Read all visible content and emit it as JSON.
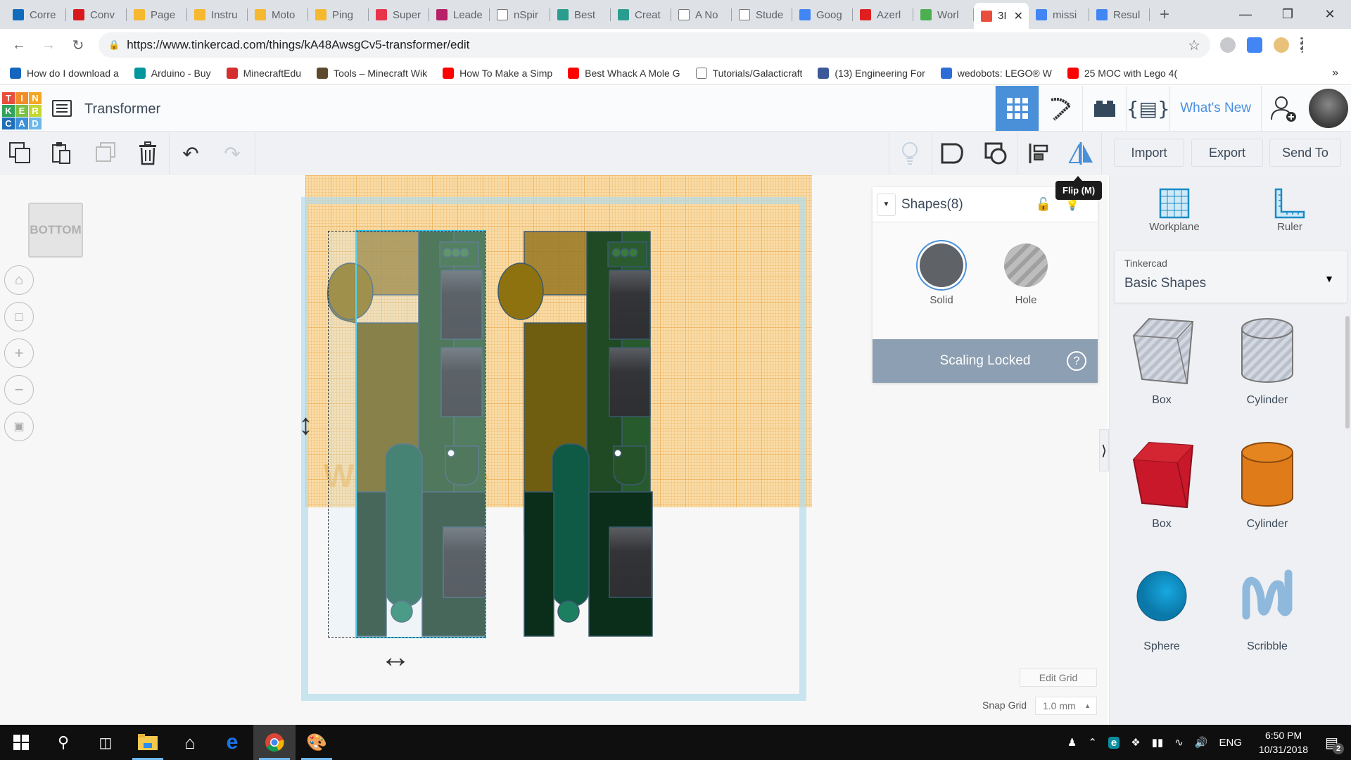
{
  "browser": {
    "tabs": [
      {
        "label": "Corre",
        "icon": "outlook-icon",
        "color": "#0f6cbd"
      },
      {
        "label": "Conv",
        "icon": "m-icon",
        "color": "#d7191c"
      },
      {
        "label": "Page",
        "icon": "instructables-icon",
        "color": "#f5b82e"
      },
      {
        "label": "Instru",
        "icon": "instructables-icon",
        "color": "#f5b82e"
      },
      {
        "label": "Moto",
        "icon": "instructables-icon",
        "color": "#f5b82e"
      },
      {
        "label": "Ping",
        "icon": "instructables-icon",
        "color": "#f5b82e"
      },
      {
        "label": "Super",
        "icon": "bulb-icon",
        "color": "#e8334a"
      },
      {
        "label": "Leade",
        "icon": "edx-icon",
        "color": "#b62168"
      },
      {
        "label": "nSpir",
        "icon": "doc-icon",
        "color": "#ffffff"
      },
      {
        "label": "Best",
        "icon": "tree-icon",
        "color": "#2a9d8f"
      },
      {
        "label": "Creat",
        "icon": "tree-icon",
        "color": "#2a9d8f"
      },
      {
        "label": "A No",
        "icon": "doc-icon",
        "color": "#ffffff"
      },
      {
        "label": "Stude",
        "icon": "doc-icon",
        "color": "#ffffff"
      },
      {
        "label": "Goog",
        "icon": "translate-icon",
        "color": "#4285f4"
      },
      {
        "label": "Azerl",
        "icon": "u-icon",
        "color": "#e02020"
      },
      {
        "label": "Worl",
        "icon": "wes-icon",
        "color": "#4caf50"
      },
      {
        "label": "3I",
        "icon": "tinkercad-icon",
        "color": "#e94e3c",
        "active": true
      },
      {
        "label": "missi",
        "icon": "google-icon",
        "color": "#4285f4"
      },
      {
        "label": "Resul",
        "icon": "google-icon",
        "color": "#4285f4"
      }
    ],
    "new_tab": "+",
    "url": "https://www.tinkercad.com/things/kA48AwsgCv5-transformer/edit",
    "bookmarks": [
      {
        "label": "How do I download a",
        "color": "#1565c0"
      },
      {
        "label": "Arduino - Buy",
        "color": "#00979c"
      },
      {
        "label": "MinecraftEdu",
        "color": "#d32f2f"
      },
      {
        "label": "Tools – Minecraft Wik",
        "color": "#5d4a2c"
      },
      {
        "label": "How To Make a Simp",
        "color": "#ff0000"
      },
      {
        "label": "Best Whack A Mole G",
        "color": "#ff0000"
      },
      {
        "label": "Tutorials/Galacticraft",
        "color": "#ffffff"
      },
      {
        "label": "(13) Engineering For",
        "color": "#3b5998"
      },
      {
        "label": "wedobots: LEGO® W",
        "color": "#2d6ed6"
      },
      {
        "label": "25 MOC with Lego 4(",
        "color": "#ff0000"
      }
    ],
    "bookmarks_more": "»"
  },
  "app": {
    "logo_letters": [
      "T",
      "I",
      "N",
      "K",
      "E",
      "R",
      "C",
      "A",
      "D"
    ],
    "logo_colors": [
      "#e84d3d",
      "#f28c28",
      "#f5a623",
      "#2ea35a",
      "#7cc142",
      "#c4d630",
      "#1e6fb8",
      "#3c8fd8",
      "#6db8e8"
    ],
    "project_title": "Transformer",
    "whats_new": "What's New",
    "accent": "#4a90d9"
  },
  "toolbar": {
    "import": "Import",
    "export": "Export",
    "send_to": "Send To",
    "tooltip": "Flip (M)"
  },
  "viewport": {
    "viewcube": "BOTTOM",
    "workplane_label": "Workplane"
  },
  "inspector": {
    "title": "Shapes(8)",
    "solid": "Solid",
    "hole": "Hole",
    "scaling": "Scaling Locked",
    "help": "?"
  },
  "grid": {
    "edit_grid": "Edit Grid",
    "snap_label": "Snap Grid",
    "snap_value": "1.0 mm"
  },
  "library": {
    "tools": [
      {
        "label": "Workplane"
      },
      {
        "label": "Ruler"
      }
    ],
    "source": "Tinkercad",
    "category": "Basic Shapes",
    "shapes": [
      {
        "label": "Box",
        "kind": "hole-box"
      },
      {
        "label": "Cylinder",
        "kind": "hole-cylinder"
      },
      {
        "label": "Box",
        "kind": "box",
        "color": "#c8182a"
      },
      {
        "label": "Cylinder",
        "kind": "cylinder",
        "color": "#e07b1a"
      },
      {
        "label": "Sphere",
        "kind": "sphere",
        "color": "#0f8fc8"
      },
      {
        "label": "Scribble",
        "kind": "scribble",
        "color": "#8fb9dc"
      }
    ]
  },
  "taskbar": {
    "time": "6:50 PM",
    "date": "10/31/2018",
    "lang": "ENG",
    "notifications": "2"
  }
}
